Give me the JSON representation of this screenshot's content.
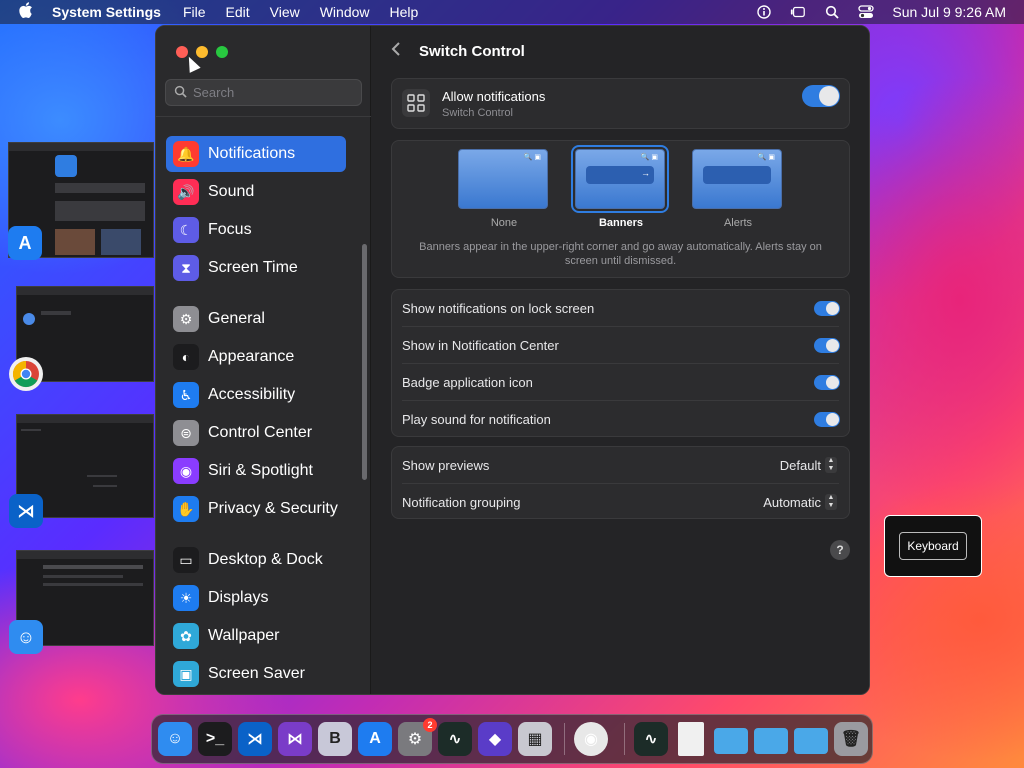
{
  "menubar": {
    "apple_icon": "apple-icon",
    "app_name": "System Settings",
    "menus": [
      "File",
      "Edit",
      "View",
      "Window",
      "Help"
    ],
    "clock": "Sun Jul 9  9:26 AM"
  },
  "sidebar": {
    "search_placeholder": "Search",
    "items": [
      {
        "label": "Notifications",
        "icon": "bell-icon",
        "color": "#ff3b30",
        "active": true
      },
      {
        "label": "Sound",
        "icon": "speaker-icon",
        "color": "#ff2d55"
      },
      {
        "label": "Focus",
        "icon": "moon-icon",
        "color": "#5e5ce6"
      },
      {
        "label": "Screen Time",
        "icon": "hourglass-icon",
        "color": "#5e5ce6"
      },
      {
        "label": "General",
        "icon": "gear-icon",
        "color": "#8e8e93"
      },
      {
        "label": "Appearance",
        "icon": "appearance-icon",
        "color": "#1c1c1e"
      },
      {
        "label": "Accessibility",
        "icon": "accessibility-icon",
        "color": "#1e7cf0"
      },
      {
        "label": "Control Center",
        "icon": "toggles-icon",
        "color": "#8e8e93"
      },
      {
        "label": "Siri & Spotlight",
        "icon": "siri-icon",
        "color": "#8a3cff"
      },
      {
        "label": "Privacy & Security",
        "icon": "hand-icon",
        "color": "#1e7cf0"
      },
      {
        "label": "Desktop & Dock",
        "icon": "dock-icon",
        "color": "#1c1c1e"
      },
      {
        "label": "Displays",
        "icon": "sun-icon",
        "color": "#1e7cf0"
      },
      {
        "label": "Wallpaper",
        "icon": "flower-icon",
        "color": "#2fa8d8"
      },
      {
        "label": "Screen Saver",
        "icon": "screensaver-icon",
        "color": "#2fa8d8"
      }
    ]
  },
  "main": {
    "title": "Switch Control",
    "allow": {
      "label": "Allow notifications",
      "sublabel": "Switch Control",
      "on": true
    },
    "styles": [
      {
        "label": "None",
        "selected": false
      },
      {
        "label": "Banners",
        "selected": true
      },
      {
        "label": "Alerts",
        "selected": false
      }
    ],
    "style_description": "Banners appear in the upper-right corner and go away automatically. Alerts stay on screen until dismissed.",
    "toggles": [
      {
        "label": "Show notifications on lock screen",
        "on": true
      },
      {
        "label": "Show in Notification Center",
        "on": true
      },
      {
        "label": "Badge application icon",
        "on": true
      },
      {
        "label": "Play sound for notification",
        "on": true
      }
    ],
    "previews": {
      "label": "Show previews",
      "value": "Default"
    },
    "grouping": {
      "label": "Notification grouping",
      "value": "Automatic"
    },
    "help": "?"
  },
  "keyboard_popup": {
    "label": "Keyboard"
  },
  "dock": {
    "items": [
      {
        "name": "finder",
        "color": "#2f8cf0",
        "glyph": "☺"
      },
      {
        "name": "terminal",
        "color": "#1c1c1e",
        "glyph": ">_"
      },
      {
        "name": "vscode",
        "color": "#0a62c8",
        "glyph": "⋊"
      },
      {
        "name": "visual-studio",
        "color": "#7a3cc8",
        "glyph": "⋈"
      },
      {
        "name": "bbedit",
        "color": "#c8c8d8",
        "glyph": "B"
      },
      {
        "name": "app-store",
        "color": "#1e7cf0",
        "glyph": "A"
      },
      {
        "name": "system-settings",
        "color": "#7a7a7e",
        "glyph": "⚙",
        "badge": "2"
      },
      {
        "name": "activity-monitor",
        "color": "#1c2c28",
        "glyph": "∿"
      },
      {
        "name": "shortcuts",
        "color": "#5a3cc8",
        "glyph": "◆"
      },
      {
        "name": "launchpad",
        "color": "#c8c8d0",
        "glyph": "▦"
      },
      {
        "name": "chrome",
        "color": "#e8e8e8",
        "glyph": "◉"
      },
      {
        "name": "activity-monitor-2",
        "color": "#1c2c28",
        "glyph": "∿"
      },
      {
        "name": "document",
        "color": "#f0f0f0",
        "glyph": ""
      },
      {
        "name": "folder-1",
        "color": "#4aa8e8",
        "glyph": ""
      },
      {
        "name": "folder-2",
        "color": "#4aa8e8",
        "glyph": ""
      },
      {
        "name": "folder-3",
        "color": "#4aa8e8",
        "glyph": ""
      },
      {
        "name": "trash",
        "color": "#9a9aa0",
        "glyph": "🗑"
      }
    ]
  }
}
